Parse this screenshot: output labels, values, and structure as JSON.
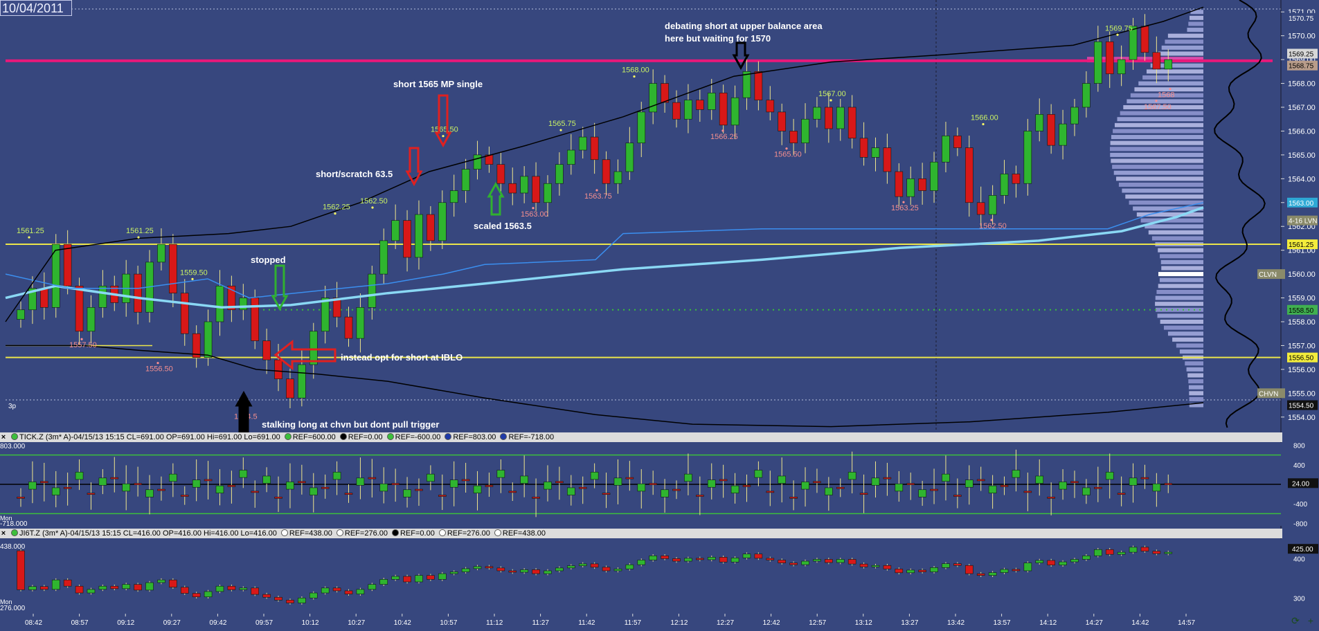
{
  "header": {
    "date": "10/04/2011"
  },
  "chart_data": {
    "type": "candlestick",
    "price_axis": {
      "ticks": [
        "1571.00",
        "1570.00",
        "1569.00",
        "1568.00",
        "1567.00",
        "1566.00",
        "1565.00",
        "1564.00",
        "1563.00",
        "1562.00",
        "1561.00",
        "1560.00",
        "1559.00",
        "1558.00",
        "1557.00",
        "1556.00",
        "1555.00",
        "1554.00"
      ],
      "ylim": [
        1553.5,
        1571.5
      ],
      "tags": [
        {
          "text": "1570.75",
          "value": 1570.75,
          "bg": "#37477e",
          "fg": "#ffffff"
        },
        {
          "text": "1569.25",
          "value": 1569.25,
          "bg": "#d7d7d7",
          "fg": "#000000"
        },
        {
          "text": "1568.75",
          "value": 1568.75,
          "bg": "#b89c8a",
          "fg": "#000000"
        },
        {
          "text": "1563.00",
          "value": 1563.0,
          "bg": "#2ea9d6",
          "fg": "#ffffff"
        },
        {
          "text": "4-16 LVN",
          "value": 1562.25,
          "bg": "#8a8a6a",
          "fg": "#ffffff"
        },
        {
          "text": "1561.25",
          "value": 1561.25,
          "bg": "#f2ec3c",
          "fg": "#000000"
        },
        {
          "text": "CLVN",
          "value": 1560.0,
          "bg": "#8a8a6a",
          "fg": "#ffffff"
        },
        {
          "text": "1558.50",
          "value": 1558.5,
          "bg": "#40b050",
          "fg": "#000000"
        },
        {
          "text": "1556.50",
          "value": 1556.5,
          "bg": "#f2ec3c",
          "fg": "#000000"
        },
        {
          "text": "CHVN",
          "value": 1555.0,
          "bg": "#8a8a6a",
          "fg": "#ffffff"
        },
        {
          "text": "1554.50",
          "value": 1554.5,
          "bg": "#111111",
          "fg": "#ffffff"
        }
      ]
    },
    "time_axis": [
      "08:42",
      "08:57",
      "09:12",
      "09:27",
      "09:42",
      "09:57",
      "10:12",
      "10:27",
      "10:42",
      "10:57",
      "11:12",
      "11:27",
      "11:42",
      "11:57",
      "12:12",
      "12:27",
      "12:42",
      "12:57",
      "13:12",
      "13:27",
      "13:42",
      "13:57",
      "14:12",
      "14:27",
      "14:42",
      "14:57"
    ],
    "price_close_path": [
      1558.5,
      1559.4,
      1558.6,
      1561.25,
      1559.5,
      1557.6,
      1558.6,
      1559.5,
      1558.8,
      1560.0,
      1558.4,
      1560.5,
      1561.25,
      1559.2,
      1557.5,
      1556.5,
      1558.0,
      1559.5,
      1558.5,
      1559.0,
      1557.2,
      1556.4,
      1555.6,
      1554.8,
      1556.2,
      1557.6,
      1559.0,
      1558.2,
      1557.3,
      1558.6,
      1560.0,
      1561.4,
      1562.25,
      1560.7,
      1562.5,
      1561.4,
      1563.0,
      1563.5,
      1564.4,
      1565.0,
      1564.6,
      1563.8,
      1563.4,
      1564.1,
      1563.0,
      1563.8,
      1564.6,
      1565.2,
      1565.75,
      1564.8,
      1563.8,
      1564.3,
      1565.5,
      1566.8,
      1568.0,
      1567.2,
      1566.5,
      1567.3,
      1566.9,
      1567.6,
      1566.25,
      1567.4,
      1568.5,
      1567.3,
      1566.8,
      1566.0,
      1565.5,
      1566.5,
      1567.0,
      1566.1,
      1567.0,
      1565.7,
      1564.9,
      1565.3,
      1564.3,
      1563.25,
      1564.0,
      1563.5,
      1564.7,
      1565.8,
      1565.3,
      1563.0,
      1562.5,
      1563.3,
      1564.2,
      1563.8,
      1566.0,
      1566.7,
      1565.4,
      1566.3,
      1567.0,
      1568.0,
      1569.75,
      1568.4,
      1569.0,
      1570.4,
      1569.3,
      1568.6,
      1569.0
    ]
  },
  "annotations": {
    "a1": "debating short at upper balance area",
    "a2": "here but waiting for 1570",
    "a3": "short 1565 MP single",
    "a4": "short/scratch 63.5",
    "a5": "scaled 1563.5",
    "a6": "stopped",
    "a7": "instead opt for short at IBLO",
    "a8": "stalking long at chvn but dont pull trigger",
    "a9": "3p"
  },
  "price_labels": {
    "hi_1561_25a": "1561.25",
    "hi_1561_25b": "1561.25",
    "hi_1559_50": "1559.50",
    "hi_1562_25": "1562.25",
    "hi_1562_50": "1562.50",
    "hi_1565_50": "1565.50",
    "hi_1565_75": "1565.75",
    "hi_1568_00": "1568.00",
    "hi_1567_00": "1567.00",
    "hi_1566_00": "1566.00",
    "hi_1569_75": "1569.75",
    "lo_1556_50": "1556.50",
    "lo_1557_50": "1557.50",
    "lo_1554_5": "1554.5",
    "lo_1563_00": "1563.00",
    "lo_1563_75": "1563.75",
    "lo_1566_25": "1566.25",
    "lo_1565_50": "1565.50",
    "lo_1563_25": "1563.25",
    "lo_1562_50": "1562.50",
    "lo_1567_50": "1567.50",
    "lo_1568": "1568"
  },
  "tick_panel": {
    "title": "TICK.Z (3m* A)-04/15/13 15:15 CL=691.00 OP=691.00 Hi=691.00 Lo=691.00",
    "refs": [
      "REF=600.00",
      "REF=0.00",
      "REF=-600.00",
      "REF=803.00",
      "REF=-718.00"
    ],
    "ref_colors": [
      "#3cbf3c",
      "#000000",
      "#3cbf3c",
      "#1f3aa8",
      "#1f3aa8"
    ],
    "top_value": "803.000",
    "bottom_value": "-718.000",
    "day_label": "Mon",
    "axis": [
      "800",
      "400",
      "-400",
      "-800"
    ],
    "current": "24.00"
  },
  "jiqt_panel": {
    "title": "JI6T.Z (3m* A)-04/15/13 15:15 CL=416.00 OP=416.00 Hi=416.00 Lo=416.00",
    "refs": [
      "REF=438.00",
      "REF=276.00",
      "REF=0.00",
      "REF=276.00",
      "REF=438.00"
    ],
    "ref_colors": [
      "#ffffff",
      "#ffffff",
      "#000000",
      "#ffffff",
      "#ffffff"
    ],
    "top_value": "438.000",
    "bottom_value": "276.000",
    "day_label": "Mon",
    "axis": [
      "400",
      "300"
    ],
    "current": "425.00"
  },
  "colors": {
    "background": "#37477e",
    "up": "#2fb52f",
    "down": "#d81818",
    "magenta": "#e8187a",
    "yellow": "#ece64a",
    "vwap": "#8ad8f4"
  }
}
